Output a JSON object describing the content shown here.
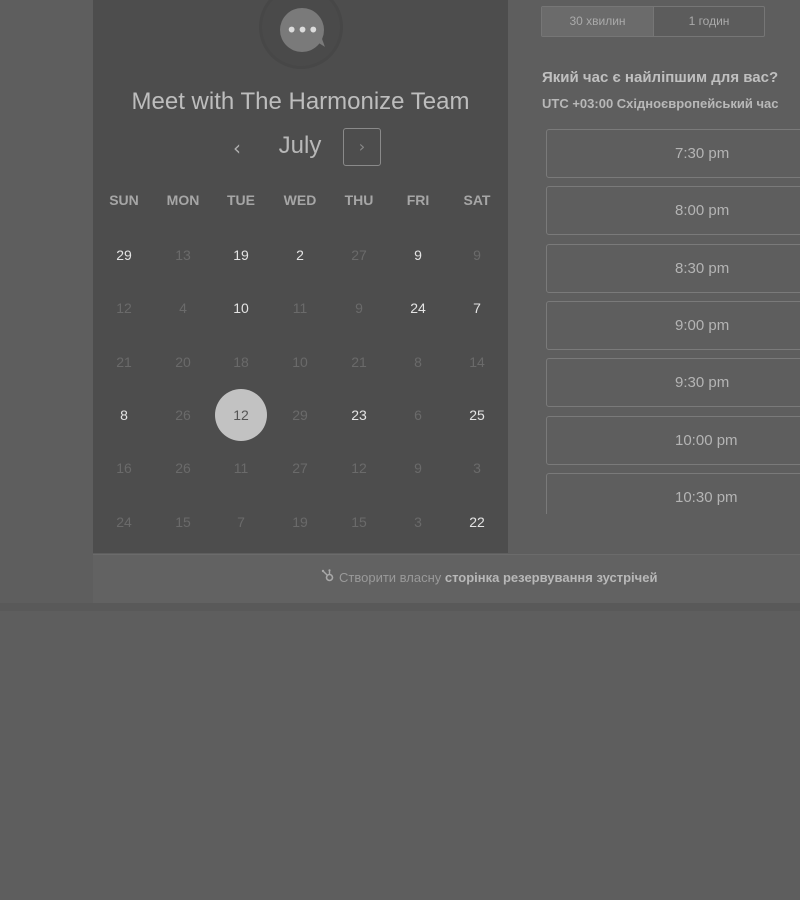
{
  "header": {
    "logo_icon": "chat-bubble-dots-icon",
    "title": "Meet with The Harmonize Team"
  },
  "calendar": {
    "month": "July",
    "prev_symbol": "‹",
    "next_symbol": "›",
    "weekdays": [
      "SUN",
      "MON",
      "TUE",
      "WED",
      "THU",
      "FRI",
      "SAT"
    ],
    "weeks": [
      [
        {
          "d": "29",
          "a": true
        },
        {
          "d": "13",
          "a": false
        },
        {
          "d": "19",
          "a": true
        },
        {
          "d": "2",
          "a": true
        },
        {
          "d": "27",
          "a": false
        },
        {
          "d": "9",
          "a": true
        },
        {
          "d": "9",
          "a": false
        }
      ],
      [
        {
          "d": "12",
          "a": false
        },
        {
          "d": "4",
          "a": false
        },
        {
          "d": "10",
          "a": true
        },
        {
          "d": "11",
          "a": false
        },
        {
          "d": "9",
          "a": false
        },
        {
          "d": "24",
          "a": true
        },
        {
          "d": "7",
          "a": true
        }
      ],
      [
        {
          "d": "21",
          "a": false
        },
        {
          "d": "20",
          "a": false
        },
        {
          "d": "18",
          "a": false
        },
        {
          "d": "10",
          "a": false
        },
        {
          "d": "21",
          "a": false
        },
        {
          "d": "8",
          "a": false
        },
        {
          "d": "14",
          "a": false
        }
      ],
      [
        {
          "d": "8",
          "a": true
        },
        {
          "d": "26",
          "a": false
        },
        {
          "d": "12",
          "a": true,
          "s": true
        },
        {
          "d": "29",
          "a": false
        },
        {
          "d": "23",
          "a": true
        },
        {
          "d": "6",
          "a": false
        },
        {
          "d": "25",
          "a": true
        }
      ],
      [
        {
          "d": "16",
          "a": false
        },
        {
          "d": "26",
          "a": false
        },
        {
          "d": "11",
          "a": false
        },
        {
          "d": "27",
          "a": false
        },
        {
          "d": "12",
          "a": false
        },
        {
          "d": "9",
          "a": false
        },
        {
          "d": "3",
          "a": false
        }
      ],
      [
        {
          "d": "24",
          "a": false
        },
        {
          "d": "15",
          "a": false
        },
        {
          "d": "7",
          "a": false
        },
        {
          "d": "19",
          "a": false
        },
        {
          "d": "15",
          "a": false
        },
        {
          "d": "3",
          "a": false
        },
        {
          "d": "22",
          "a": true
        }
      ]
    ]
  },
  "duration": {
    "tabs": [
      {
        "label": "30 хвилин",
        "selected": true
      },
      {
        "label": "1 годин",
        "selected": false
      }
    ]
  },
  "times": {
    "question": "Який час є найліпшим для вас?",
    "timezone": "UTC +03:00 Східноєвропейський час",
    "slots": [
      "7:30 pm",
      "8:00 pm",
      "8:30 pm",
      "9:00 pm",
      "9:30 pm",
      "10:00 pm",
      "10:30 pm"
    ]
  },
  "footer": {
    "icon": "hubspot-sprocket-icon",
    "text_plain": "Створити власну ",
    "text_bold": "сторінка резервування зустрічей"
  },
  "colors": {
    "page_background": "#5e5e5e",
    "calendar_panel": "#4d4d4d",
    "selected_day": "#c2c2c2"
  }
}
